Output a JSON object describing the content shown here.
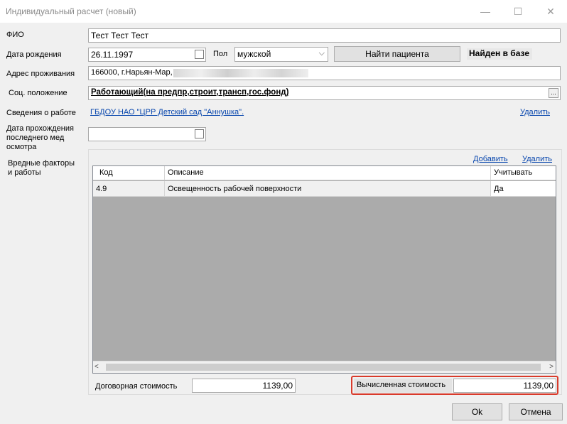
{
  "window": {
    "title": "Индивидуальный расчет (новый)",
    "minimize_glyph": "—",
    "maximize_glyph": "☐",
    "close_glyph": "✕"
  },
  "form": {
    "fio_label": "ФИО",
    "fio_value": "Тест Тест Тест",
    "birth_label": "Дата рождения",
    "birth_value": "26.11.1997",
    "sex_label": "Пол",
    "sex_value": "мужской",
    "find_patient_label": "Найти пациента",
    "found_status": "Найден в базе",
    "address_label": "Адрес проживания",
    "address_value": "166000, г.Нарьян-Мар,",
    "social_label": "Соц. положение",
    "social_value": "Работающий(на предпр,строит,трансп,гос.фонд)",
    "social_button": "...",
    "work_label": "Сведения о работе",
    "work_value": "ГБДОУ НАО \"ЦРР Детский сад \"Аннушка\".",
    "work_delete": "Удалить",
    "medexam_label": "Дата прохождения последнего мед осмотра",
    "medexam_value": "",
    "harmful_label": "Вредные факторы и работы"
  },
  "factors": {
    "add_link": "Добавить",
    "delete_link": "Удалить",
    "columns": [
      "Код",
      "Описание",
      "Учитывать"
    ],
    "rows": [
      {
        "code": "4.9",
        "description": "Освещенность рабочей поверхности",
        "consider": "Да"
      }
    ]
  },
  "costs": {
    "contract_label": "Договорная стоимость",
    "contract_value": "1139,00",
    "calculated_label": "Вычисленная стоимость",
    "calculated_value": "1139,00",
    "highlight_color": "#d93a2b"
  },
  "buttons": {
    "ok": "Ok",
    "cancel": "Отмена"
  }
}
